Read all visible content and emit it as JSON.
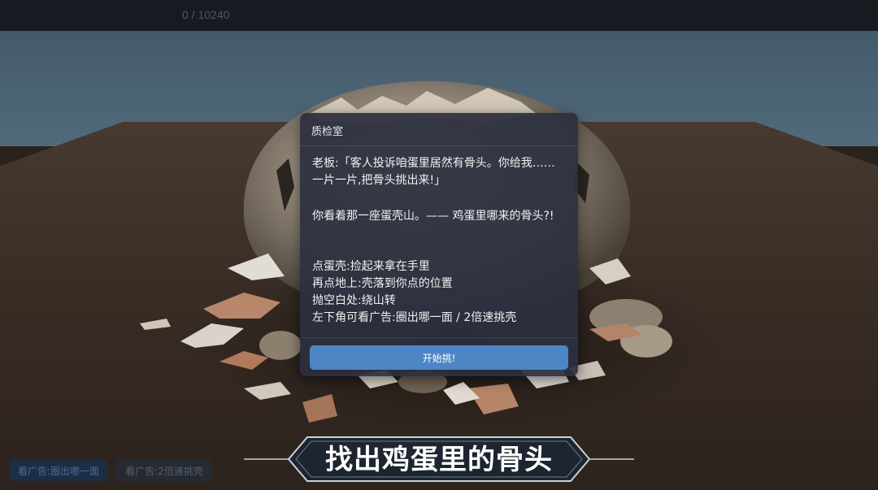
{
  "hud": {
    "counter": "0 / 10240"
  },
  "dialog": {
    "title": "质检室",
    "lines": [
      "老板:「客人投诉咱蛋里居然有骨头。你给我……一片一片,把骨头挑出来!」",
      "你看着那一座蛋壳山。—— 鸡蛋里哪来的骨头?!",
      "点蛋壳:捡起来拿在手里",
      "再点地上:壳落到你点的位置",
      "抛空白处:绕山转",
      "左下角可看广告:圈出哪一面 / 2倍速挑壳"
    ],
    "start_button": "开始挑!"
  },
  "ads": {
    "circle_label": "看广告:圈出哪一面",
    "speed_label": "看广告:2倍速挑壳"
  },
  "banner": {
    "title": "找出鸡蛋里的骨头"
  },
  "colors": {
    "top_bar": "#161b21",
    "sky": "#4a6274",
    "ground": "#3a2e26",
    "modal_bg": "#2c2f40",
    "button_primary": "#4d86c4",
    "ad_button_circle": "#1d2d44",
    "ad_button_speed": "#262a33",
    "banner_bg": "#1d2630",
    "banner_border": "#c9d2dc"
  }
}
